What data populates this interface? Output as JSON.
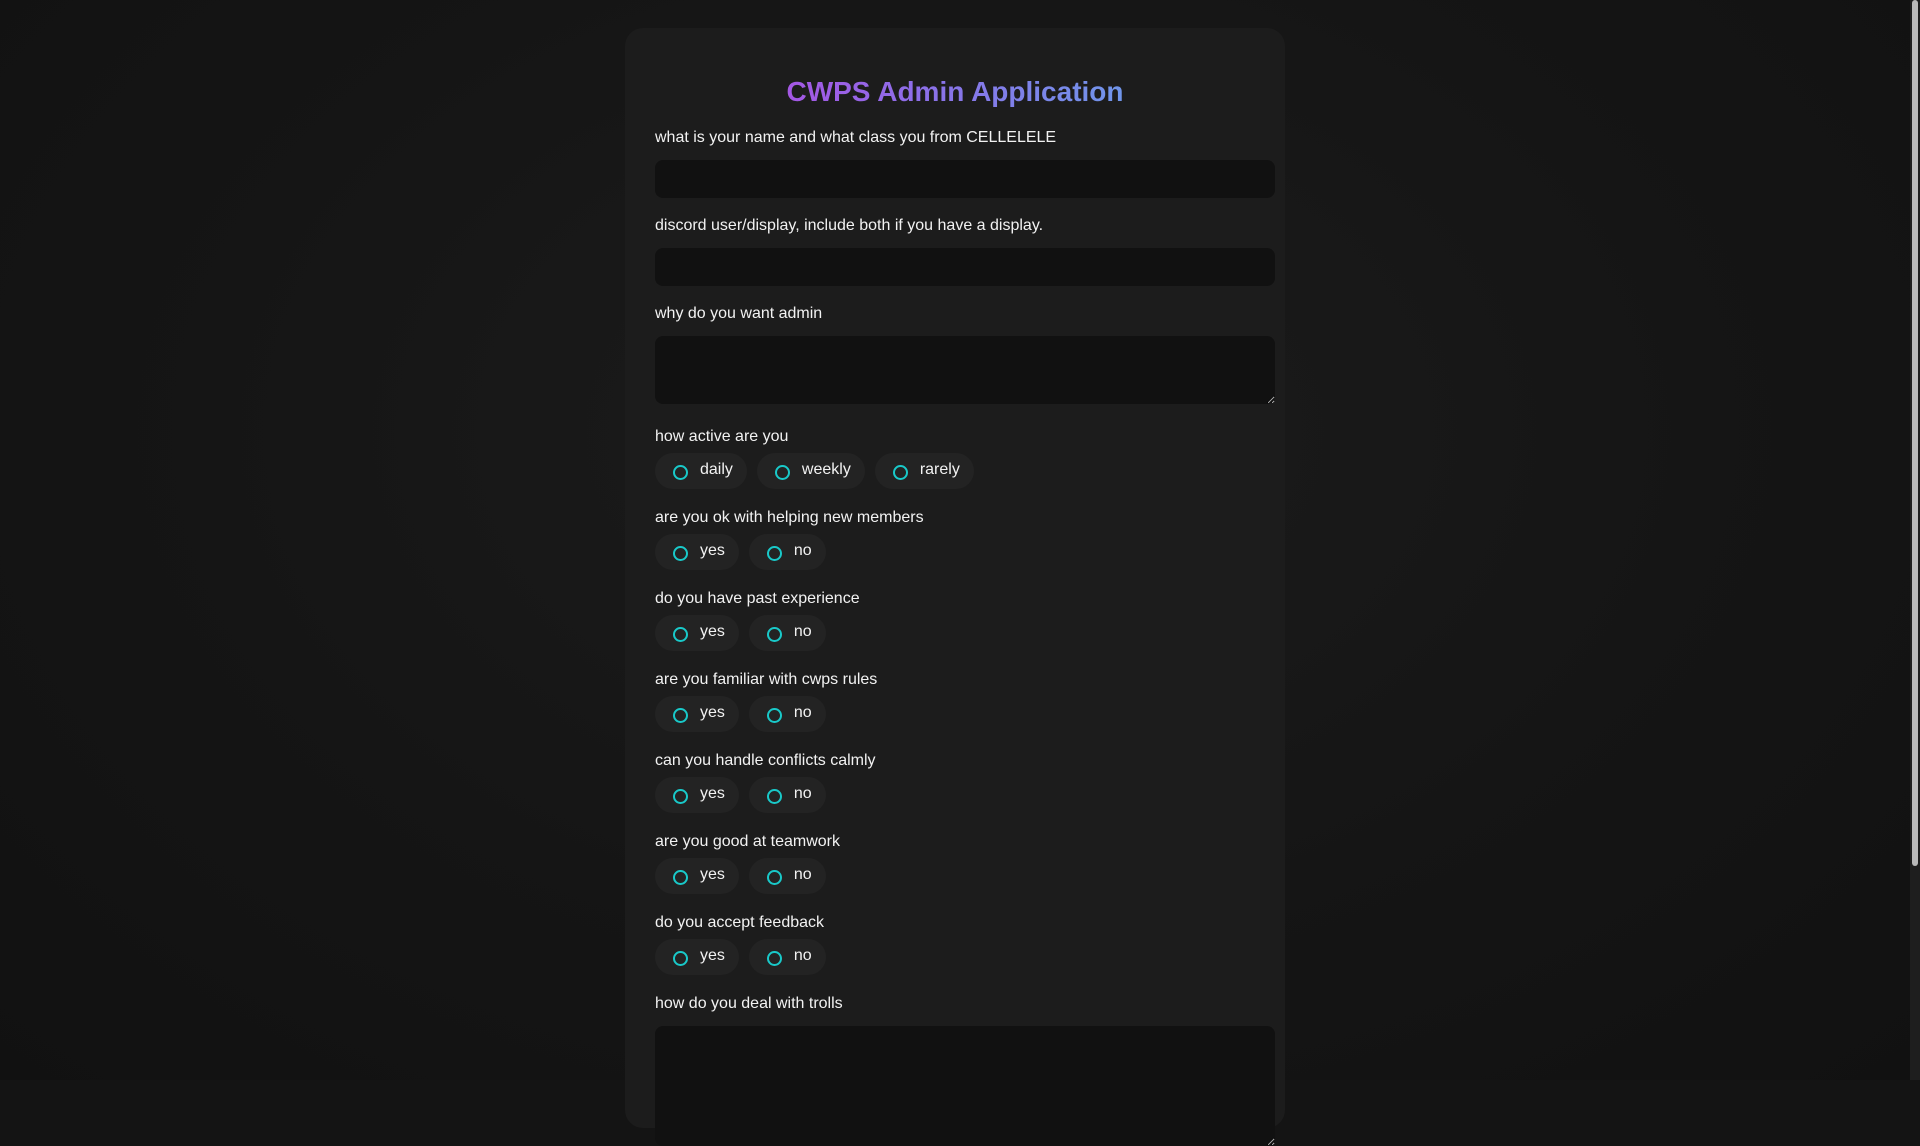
{
  "form": {
    "title": "CWPS Admin Application",
    "questions": {
      "name": {
        "label": "what is your name and what class you from CELLELELE",
        "value": ""
      },
      "discord": {
        "label": "discord user/display, include both if you have a display.",
        "value": ""
      },
      "why_admin": {
        "label": "why do you want admin",
        "value": ""
      },
      "activity": {
        "label": "how active are you",
        "options": [
          "daily",
          "weekly",
          "rarely"
        ]
      },
      "helping": {
        "label": "are you ok with helping new members",
        "options": [
          "yes",
          "no"
        ]
      },
      "experience": {
        "label": "do you have past experience",
        "options": [
          "yes",
          "no"
        ]
      },
      "rules": {
        "label": "are you familiar with cwps rules",
        "options": [
          "yes",
          "no"
        ]
      },
      "conflicts": {
        "label": "can you handle conflicts calmly",
        "options": [
          "yes",
          "no"
        ]
      },
      "teamwork": {
        "label": "are you good at teamwork",
        "options": [
          "yes",
          "no"
        ]
      },
      "feedback": {
        "label": "do you accept feedback",
        "options": [
          "yes",
          "no"
        ]
      },
      "trolls": {
        "label": "how do you deal with trolls",
        "value": ""
      }
    }
  },
  "colors": {
    "background": "#141414",
    "card": "#1c1c1c",
    "field": "#111111",
    "pill": "#232323",
    "radio_accent": "#19c9c9",
    "title_gradient": [
      "#c23be0",
      "#8c6fe8",
      "#5ab4ec"
    ]
  }
}
